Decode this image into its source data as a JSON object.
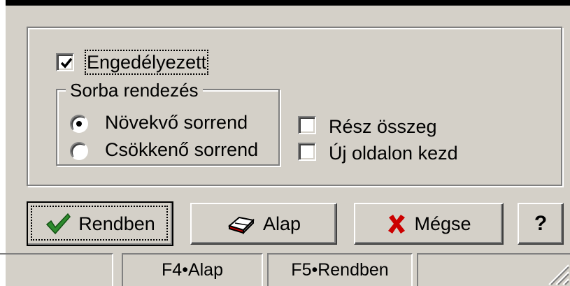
{
  "enabled": {
    "label": "Engedélyezett",
    "checked": true
  },
  "sort_group": {
    "title": "Sorba rendezés",
    "options": [
      {
        "label": "Növekvő sorrend",
        "selected": true
      },
      {
        "label": "Csökkenő sorrend",
        "selected": false
      }
    ]
  },
  "options": {
    "subtotal": {
      "label": "Rész összeg",
      "checked": false
    },
    "new_page": {
      "label": "Új oldalon kezd",
      "checked": false
    }
  },
  "buttons": {
    "ok": {
      "label": "Rendben",
      "icon": "checkmark-icon"
    },
    "reset": {
      "label": "Alap",
      "icon": "eraser-icon"
    },
    "cancel": {
      "label": "Mégse",
      "icon": "cross-icon"
    },
    "help": {
      "label": "?"
    }
  },
  "statusbar": {
    "panes": [
      "",
      "F4•Alap",
      "F5•Rendben",
      ""
    ]
  },
  "colors": {
    "face": "#d4d0c8",
    "check_green": "#2e8b2e",
    "cancel_red": "#cc0000"
  }
}
